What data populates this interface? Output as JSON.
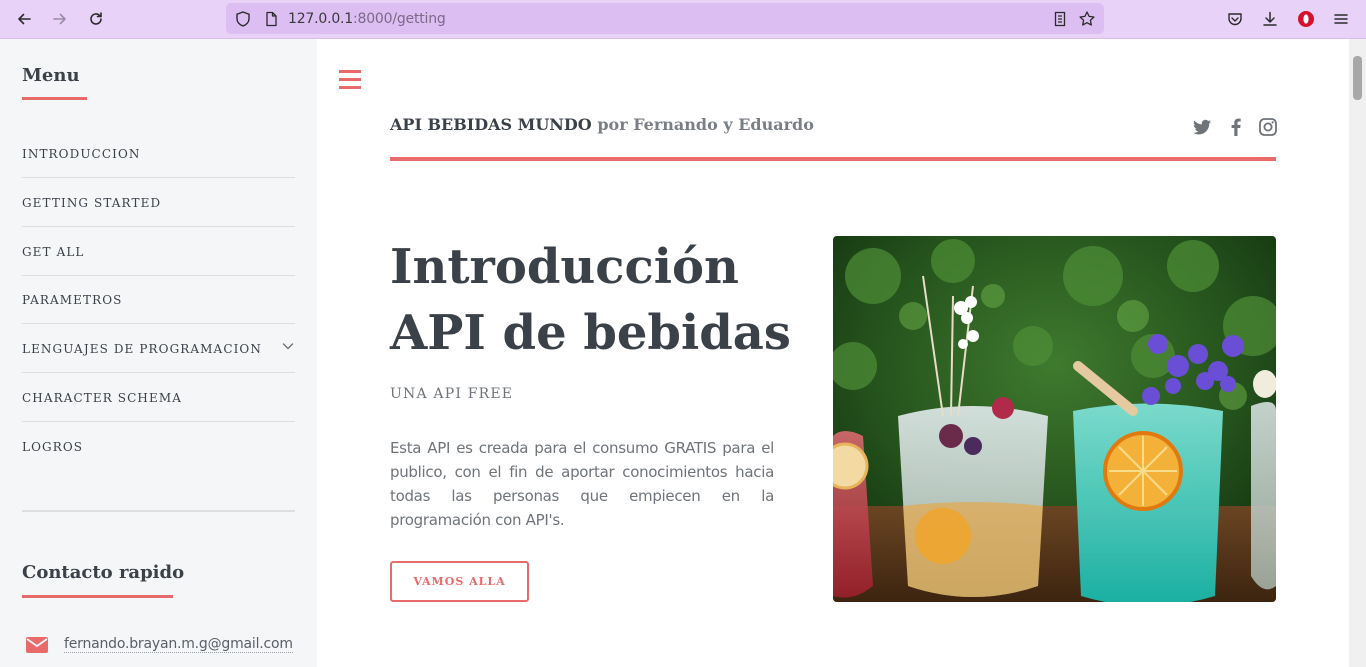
{
  "browser": {
    "url_host": "127.0.0.1",
    "url_rest": ":8000/getting"
  },
  "sidebar": {
    "menu_heading": "Menu",
    "items": [
      {
        "label": "INTRODUCCION"
      },
      {
        "label": "GETTING STARTED"
      },
      {
        "label": "GET ALL"
      },
      {
        "label": "PARAMETROS"
      },
      {
        "label": "LENGUAJES DE PROGRAMACION"
      },
      {
        "label": "CHARACTER SCHEMA"
      },
      {
        "label": "LOGROS"
      }
    ],
    "contact_heading": "Contacto rapido",
    "email": "fernando.brayan.m.g@gmail.com"
  },
  "header": {
    "brand": "API BEBIDAS MUNDO",
    "brand_by": "por Fernando y Eduardo"
  },
  "hero": {
    "title_line1": "Introducción",
    "title_line2": "API de bebidas",
    "subtitle": "UNA API FREE",
    "description": "Esta API es creada para el consumo GRATIS para el publico, con el fin de aportar conocimientos hacia todas las personas que empiecen en la programación con API's.",
    "cta_label": "VAMOS ALLA"
  },
  "colors": {
    "accent": "#e86a6a",
    "chrome": "#e9d2f7",
    "text_dark": "#3b4148"
  },
  "icons": [
    "back-icon",
    "forward-icon",
    "reload-icon",
    "shield-icon",
    "page-icon",
    "reader-icon",
    "star-icon",
    "pocket-icon",
    "download-icon",
    "opera-icon",
    "menu-icon",
    "hamburger-icon",
    "twitter-icon",
    "facebook-icon",
    "instagram-icon",
    "envelope-icon",
    "chevron-down-icon"
  ]
}
